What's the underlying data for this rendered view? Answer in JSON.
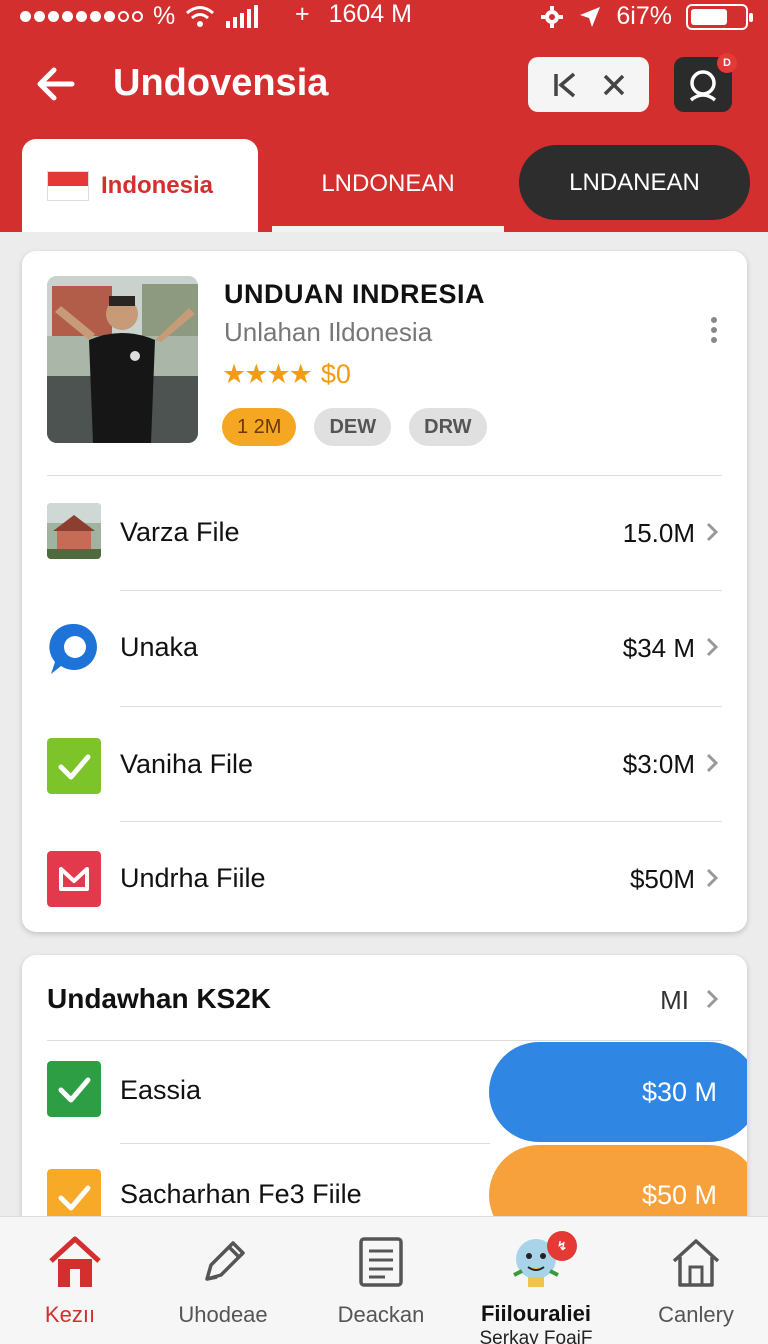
{
  "status_bar": {
    "signal_text": "%",
    "time": "1604 M",
    "time_prefix": "+",
    "battery_text": "6i7%"
  },
  "header": {
    "title": "Undovensia",
    "control_icons": [
      "skip-back-icon",
      "close-icon"
    ],
    "profile_badge": "D"
  },
  "tabs": [
    {
      "label": "Indonesia",
      "active": true
    },
    {
      "label": "LNDONEAN"
    },
    {
      "label": "LNDANEAN"
    }
  ],
  "product": {
    "title": "UNDUAN INDRESIA",
    "subtitle": "Unlahan Ildonesia",
    "stars": "★★★★",
    "price": "$0",
    "badges": [
      "1 2M",
      "DEW",
      "DRW"
    ]
  },
  "files": [
    {
      "icon": "house-thumbnail-icon",
      "label": "Varza File",
      "value": "15.0M"
    },
    {
      "icon": "chat-bubble-icon",
      "label": "Unaka",
      "value": "$34 M"
    },
    {
      "icon": "checkbox-green-icon",
      "label": "Vaniha File",
      "value": "$3:0M"
    },
    {
      "icon": "mail-icon",
      "label": "Undrha Fiile",
      "value": "$50M"
    }
  ],
  "section": {
    "title": "Undawhan KS2K",
    "more_label": "MI",
    "items": [
      {
        "icon": "checkbox-green-icon",
        "label": "Eassia",
        "button": "$30 M"
      },
      {
        "icon": "checkbox-orange-icon",
        "label": "Sacharhan Fe3 Fiile",
        "button": "$50 M"
      }
    ]
  },
  "bottom_nav": [
    {
      "icon": "home-icon",
      "label": "Kezıı",
      "active": true
    },
    {
      "icon": "pen-icon",
      "label": "Uhodeae"
    },
    {
      "icon": "document-icon",
      "label": "Deackan"
    },
    {
      "icon": "mascot-icon",
      "label": "Fiilouraliei",
      "sub": "Serkay FoaiF",
      "badge": "↯"
    },
    {
      "icon": "house-outline-icon",
      "label": "Canlery"
    }
  ],
  "colors": {
    "brand_red": "#d32f2f",
    "accent_orange": "#f39c12",
    "button_blue": "#2f87e3",
    "button_orange": "#f7a13c"
  }
}
